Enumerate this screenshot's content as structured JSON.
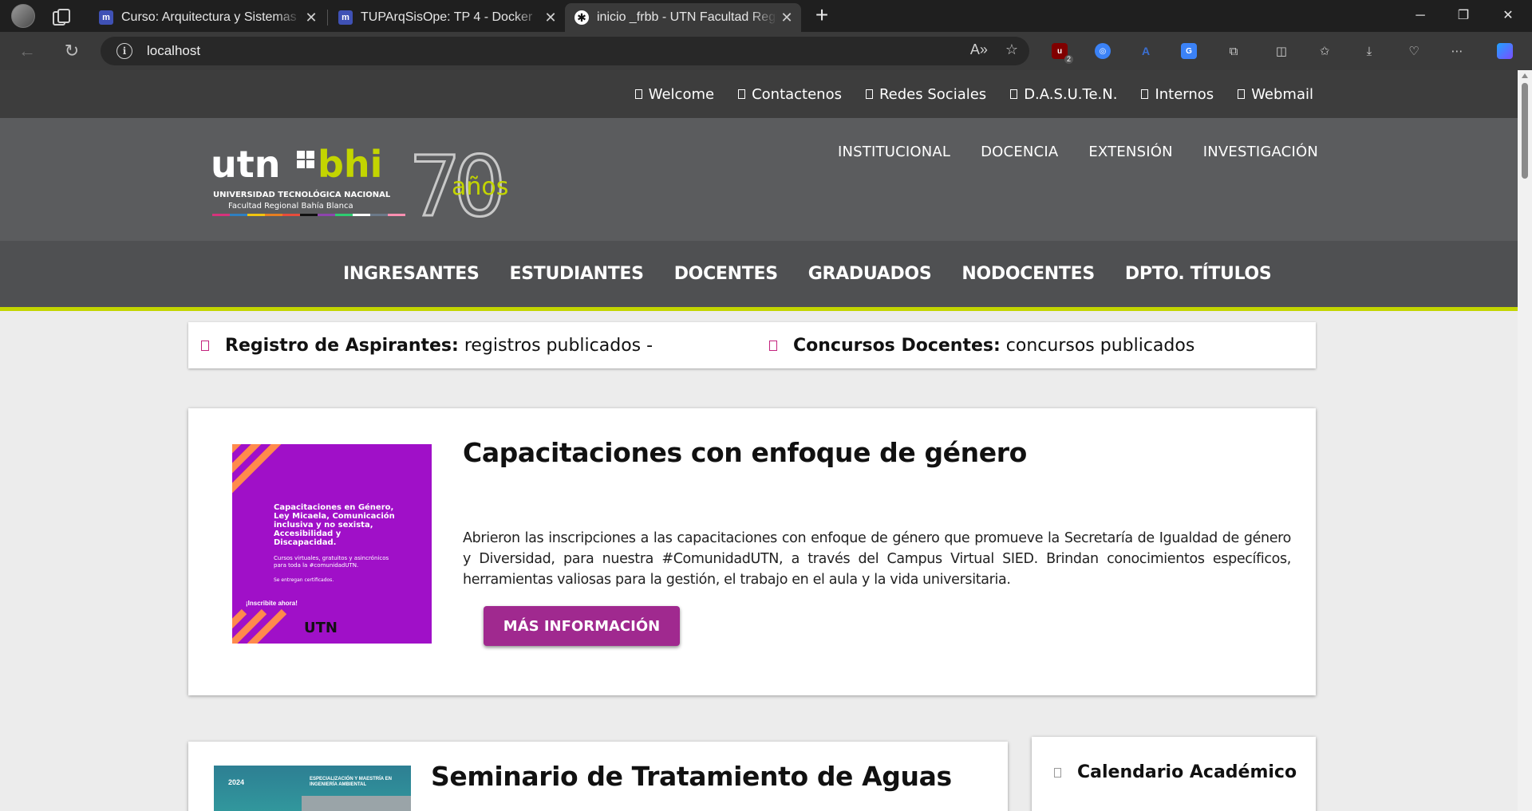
{
  "browser": {
    "tabs": [
      {
        "title": "Curso: Arquitectura y Sistemas Operativos",
        "favicon": "moodle-icon"
      },
      {
        "title": "TUPArqSisOpe: TP 4 - Docker",
        "favicon": "moodle-icon"
      },
      {
        "title": "inicio _frbb - UTN Facultad Regional Bahía Blanca",
        "favicon": "utn-icon",
        "active": true
      }
    ],
    "url": "localhost",
    "extension_badge": "2"
  },
  "site": {
    "top_links": [
      "Welcome",
      "Contactenos",
      "Redes Sociales",
      "D.A.S.U.Te.N.",
      "Internos",
      "Webmail"
    ],
    "logo": {
      "brand_left": "utn",
      "brand_right": "bhi",
      "line1": "UNIVERSIDAD TECNOLÓGICA NACIONAL",
      "line2": "Facultad Regional Bahía Blanca",
      "anniversary_number": "70",
      "anniversary_word": "años"
    },
    "main_nav": [
      "INSTITUCIONAL",
      "DOCENCIA",
      "EXTENSIÓN",
      "INVESTIGACIÓN"
    ],
    "sub_nav": [
      "INGRESANTES",
      "ESTUDIANTES",
      "DOCENTES",
      "GRADUADOS",
      "NODOCENTES",
      "DPTO. TÍTULOS"
    ],
    "notices": [
      {
        "label": "Registro de Aspirantes:",
        "text": "registros publicados -"
      },
      {
        "label": "Concursos Docentes:",
        "text": "concursos publicados"
      }
    ],
    "featured": {
      "title": "Capacitaciones con enfoque de género",
      "body": "Abrieron las inscripciones a las capacitaciones con enfoque de género que promueve la Secretaría de Igualdad de género y Diversidad, para nuestra #ComunidadUTN, a través del Campus Virtual SIED. Brindan conocimientos específicos, herramientas valiosas para la gestión, el trabajo en el aula y la vida universitaria.",
      "button": "MÁS INFORMACIÓN",
      "poster": {
        "heading": "Capacitaciones en Género, Ley Micaela, Comunicación inclusiva y no sexista, Accesibilidad y Discapacidad.",
        "sub": "Cursos virtuales, gratuitos y asincrónicos para toda la #comunidadUTN.",
        "note": "Se entregan certificados.",
        "cta": "¡Inscribite ahora!",
        "brand": "UTN"
      }
    },
    "second": {
      "title": "Seminario de Tratamiento de Aguas",
      "thumb_year": "2024",
      "thumb_label": "ESPECIALIZACIÓN Y MAESTRÍA EN INGENIERÍA AMBIENTAL"
    },
    "sidebar": {
      "title": "Calendario Académico"
    }
  },
  "colors": {
    "accent_lime": "#c3d500",
    "button_purple": "#a0298f",
    "poster_purple": "#a010c8",
    "notice_magenta": "#c3237e"
  }
}
